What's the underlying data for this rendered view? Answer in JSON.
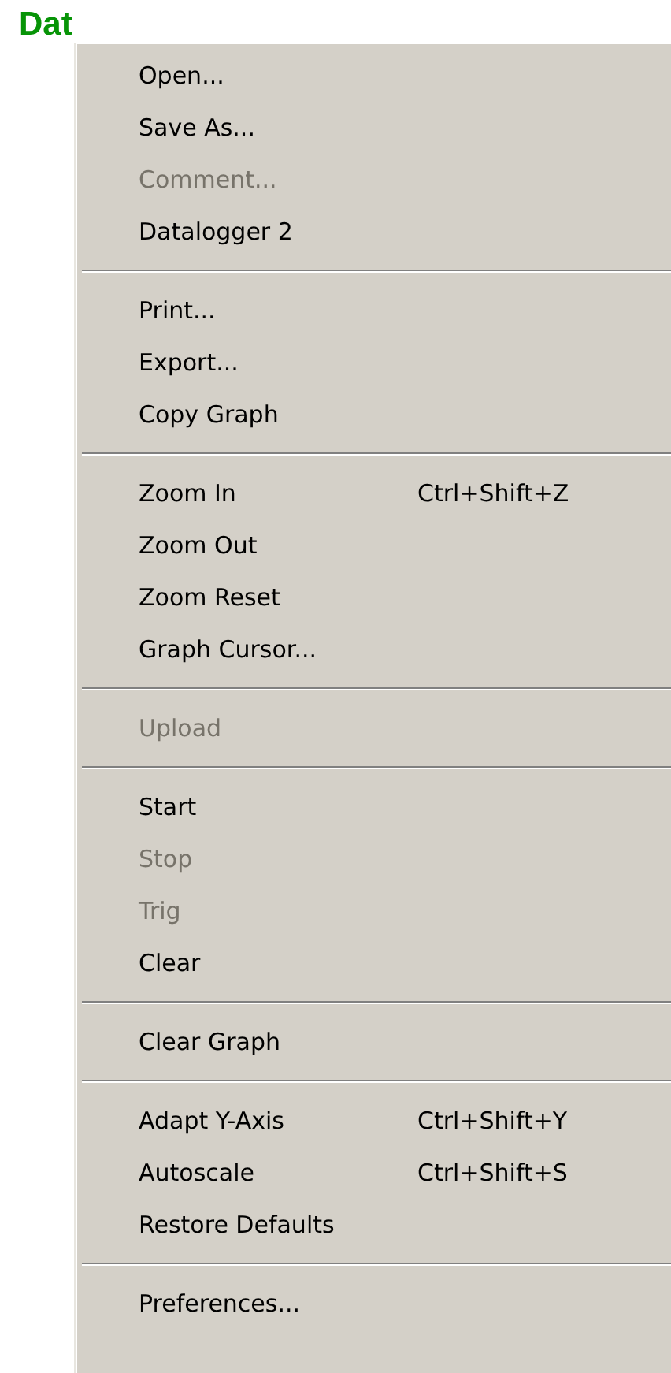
{
  "title": "Dat",
  "menu": {
    "groups": [
      [
        {
          "label": "Open...",
          "disabled": false
        },
        {
          "label": "Save As...",
          "disabled": false
        },
        {
          "label": "Comment...",
          "disabled": true
        },
        {
          "label": "Datalogger 2",
          "disabled": false
        }
      ],
      [
        {
          "label": "Print...",
          "disabled": false
        },
        {
          "label": "Export...",
          "disabled": false
        },
        {
          "label": "Copy Graph",
          "disabled": false
        }
      ],
      [
        {
          "label": "Zoom In",
          "shortcut": "Ctrl+Shift+Z",
          "disabled": false
        },
        {
          "label": "Zoom Out",
          "disabled": false
        },
        {
          "label": "Zoom Reset",
          "disabled": false
        },
        {
          "label": "Graph Cursor...",
          "disabled": false
        }
      ],
      [
        {
          "label": "Upload",
          "disabled": true
        }
      ],
      [
        {
          "label": "Start",
          "disabled": false
        },
        {
          "label": "Stop",
          "disabled": true
        },
        {
          "label": "Trig",
          "disabled": true
        },
        {
          "label": "Clear",
          "disabled": false
        }
      ],
      [
        {
          "label": "Clear Graph",
          "disabled": false
        }
      ],
      [
        {
          "label": "Adapt Y-Axis",
          "shortcut": "Ctrl+Shift+Y",
          "disabled": false
        },
        {
          "label": "Autoscale",
          "shortcut": "Ctrl+Shift+S",
          "disabled": false
        },
        {
          "label": "Restore Defaults",
          "disabled": false
        }
      ],
      [
        {
          "label": "Preferences...",
          "disabled": false
        }
      ]
    ]
  }
}
